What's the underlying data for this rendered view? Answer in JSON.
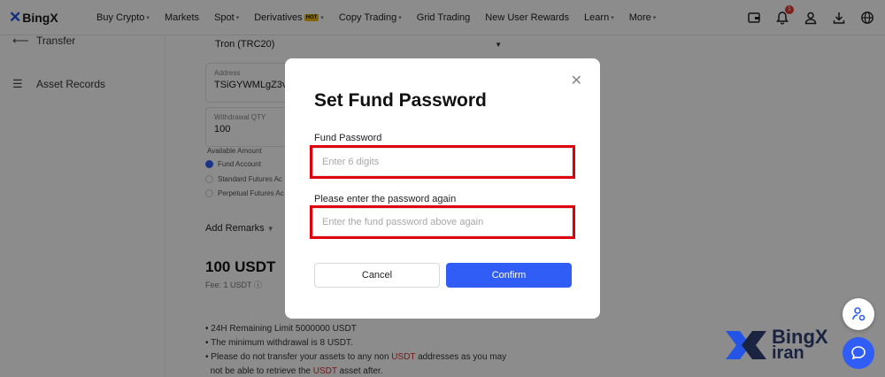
{
  "nav": {
    "logo_text": "BingX",
    "items": [
      {
        "label": "Buy Crypto",
        "caret": true
      },
      {
        "label": "Markets",
        "caret": false
      },
      {
        "label": "Spot",
        "caret": true
      },
      {
        "label": "Derivatives",
        "caret": true,
        "badge": "HOT"
      },
      {
        "label": "Copy Trading",
        "caret": true
      },
      {
        "label": "Grid Trading",
        "caret": false
      },
      {
        "label": "New User Rewards",
        "caret": false
      },
      {
        "label": "Learn",
        "caret": true
      },
      {
        "label": "More",
        "caret": true
      }
    ],
    "notification_count": "1",
    "icons": [
      "wallet-icon",
      "bell-icon",
      "user-icon",
      "download-icon",
      "globe-icon"
    ]
  },
  "sidebar": {
    "items": [
      {
        "label": "Transfer",
        "icon": "arrow-left-icon"
      },
      {
        "label": "Asset Records",
        "icon": "list-icon"
      }
    ]
  },
  "form": {
    "network": "Tron (TRC20)",
    "address_label": "Address",
    "address_value": "TSiGYWMLgZ3v",
    "qty_label": "Withdrawal QTY",
    "qty_value": "100",
    "available_label": "Available Amount",
    "accounts": [
      {
        "label": "Fund Account",
        "selected": true
      },
      {
        "label": "Standard Futures Ac",
        "selected": false
      },
      {
        "label": "Perpetual Futures Ac",
        "selected": false
      }
    ],
    "remarks": "Add Remarks",
    "amount": "100 USDT",
    "fee": "Fee:  1 USDT",
    "notes": {
      "line1": "24H Remaining Limit 5000000 USDT",
      "line2": "The minimum withdrawal is 8 USDT.",
      "line3_a": "Please do not transfer your assets to any non ",
      "line3_red": "USDT",
      "line3_b": " addresses as you may",
      "line4_a": "not be able to retrieve the ",
      "line4_red": "USDT",
      "line4_b": " asset after."
    }
  },
  "modal": {
    "title": "Set Fund Password",
    "password_label": "Fund Password",
    "password_placeholder": "Enter 6 digits",
    "confirm_label": "Please enter the password again",
    "confirm_placeholder": "Enter the fund password above again",
    "cancel_label": "Cancel",
    "confirm_button": "Confirm",
    "close_glyph": "✕"
  },
  "watermark": {
    "line1": "BingX",
    "line2": "iran"
  },
  "colors": {
    "accent": "#2f5df6",
    "highlight": "#e0000b",
    "logo": "#2354e6"
  }
}
